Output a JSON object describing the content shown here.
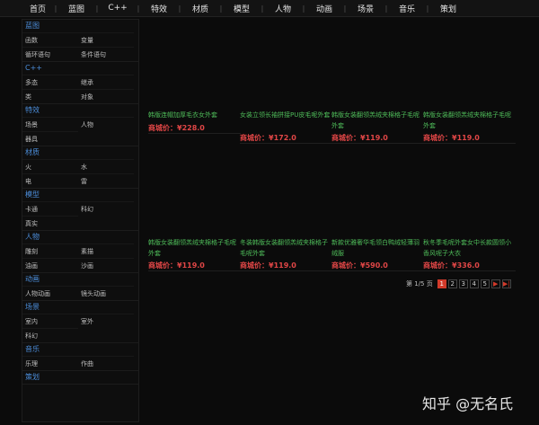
{
  "nav": [
    "首页",
    "蓝图",
    "C++",
    "特效",
    "材质",
    "模型",
    "人物",
    "动画",
    "场景",
    "音乐",
    "策划"
  ],
  "sidebar": [
    {
      "title": "蓝图",
      "items": [
        "函数",
        "变量",
        "循环语句",
        "条件语句"
      ]
    },
    {
      "title": "C++",
      "items": [
        "多态",
        "继承",
        "类",
        "对象"
      ]
    },
    {
      "title": "特效",
      "items": [
        "场景",
        "人物",
        "器具"
      ]
    },
    {
      "title": "材质",
      "items": [
        "火",
        "水",
        "电",
        "雷"
      ]
    },
    {
      "title": "模型",
      "items": [
        "卡通",
        "科幻",
        "真实"
      ]
    },
    {
      "title": "人物",
      "items": [
        "雕刻",
        "素描",
        "油画",
        "沙画"
      ]
    },
    {
      "title": "动画",
      "items": [
        "人物动画",
        "镜头动画"
      ]
    },
    {
      "title": "场景",
      "items": [
        "室内",
        "室外",
        "科幻"
      ]
    },
    {
      "title": "音乐",
      "items": [
        "乐理",
        "作曲"
      ]
    },
    {
      "title": "策划",
      "items": []
    }
  ],
  "price_label": "商城价：",
  "products": [
    {
      "name": "韩版连帽加厚毛衣女外套",
      "price": "¥228.0"
    },
    {
      "name": "女装立领长袖拼接PU皮毛呢外套",
      "price": "¥172.0"
    },
    {
      "name": "韩版女装翻领羔绒夹棉格子毛呢外套",
      "price": "¥119.0"
    },
    {
      "name": "韩版女装翻领羔绒夹棉格子毛呢外套",
      "price": "¥119.0"
    },
    {
      "name": "韩版女装翻领羔绒夹棉格子毛呢外套",
      "price": "¥119.0"
    },
    {
      "name": "冬装韩版女装翻领羔绒夹棉格子毛呢外套",
      "price": "¥119.0"
    },
    {
      "name": "新款优雅奢华毛领白鸭绒轻薄羽绒服",
      "price": "¥590.0"
    },
    {
      "name": "秋冬季毛呢外套女中长款圆领小香风呢子大衣",
      "price": "¥336.0"
    }
  ],
  "pager": {
    "info": "第 1/5 页",
    "pages": [
      "1",
      "2",
      "3",
      "4",
      "5"
    ],
    "next": "▶",
    "last": "▶|"
  },
  "watermark": "知乎 @无名氏"
}
